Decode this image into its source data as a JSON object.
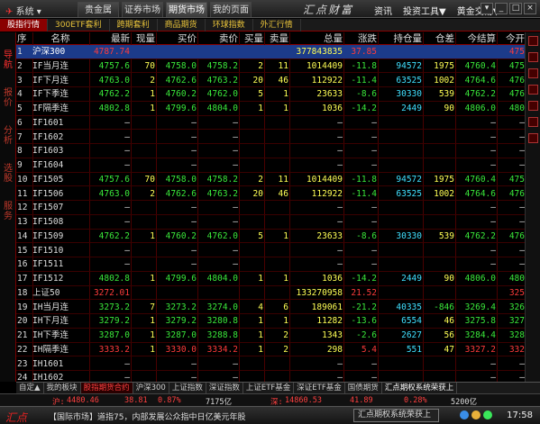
{
  "window": {
    "sys_menu": "系统",
    "top_tabs": [
      "贵金属",
      "证券市场",
      "期货市场",
      "我的页面"
    ],
    "active_top_tab": 2,
    "brand": "汇点财富",
    "top_menu": [
      "资讯",
      "投资工具▼",
      "黄金交易▼"
    ],
    "win_buttons": [
      "▾",
      "_",
      "□",
      "×"
    ]
  },
  "subtabs": {
    "items": [
      "股指行情",
      "300ETF套利",
      "跨期套利",
      "商品期货",
      "环球指数",
      "外汇行情"
    ],
    "active": 0
  },
  "left_strip": {
    "items": [
      "导航",
      "报价",
      "分析",
      "选股",
      "服务"
    ]
  },
  "table": {
    "headers": [
      "序",
      "名称",
      "最新",
      "现量",
      "买价",
      "卖价",
      "买量",
      "卖量",
      "总量",
      "涨跌",
      "持仓量",
      "仓差",
      "今结算",
      "今开"
    ],
    "rows": [
      [
        "1",
        "沪深300",
        "4787.74",
        "",
        "",
        "",
        "",
        "",
        "377843835",
        "37.85",
        "",
        "",
        "",
        "475"
      ],
      [
        "2",
        "IF当月连",
        "4757.6",
        "70",
        "4758.0",
        "4758.2",
        "2",
        "11",
        "1014409",
        "-11.8",
        "94572",
        "1975",
        "4760.4",
        "475"
      ],
      [
        "3",
        "IF下月连",
        "4763.0",
        "2",
        "4762.6",
        "4763.2",
        "20",
        "46",
        "112922",
        "-11.4",
        "63525",
        "1002",
        "4764.6",
        "476"
      ],
      [
        "4",
        "IF下季连",
        "4762.2",
        "1",
        "4760.2",
        "4762.0",
        "5",
        "1",
        "23633",
        "-8.6",
        "30330",
        "539",
        "4762.2",
        "476"
      ],
      [
        "5",
        "IF隔季连",
        "4802.8",
        "1",
        "4799.6",
        "4804.0",
        "1",
        "1",
        "1036",
        "-14.2",
        "2449",
        "90",
        "4806.0",
        "480"
      ],
      [
        "6",
        "IF1601",
        "",
        "",
        "",
        "",
        "",
        "",
        "",
        "",
        "",
        "",
        "",
        ""
      ],
      [
        "7",
        "IF1602",
        "",
        "",
        "",
        "",
        "",
        "",
        "",
        "",
        "",
        "",
        "",
        ""
      ],
      [
        "8",
        "IF1603",
        "",
        "",
        "",
        "",
        "",
        "",
        "",
        "",
        "",
        "",
        "",
        ""
      ],
      [
        "9",
        "IF1604",
        "",
        "",
        "",
        "",
        "",
        "",
        "",
        "",
        "",
        "",
        "",
        ""
      ],
      [
        "10",
        "IF1505",
        "4757.6",
        "70",
        "4758.0",
        "4758.2",
        "2",
        "11",
        "1014409",
        "-11.8",
        "94572",
        "1975",
        "4760.4",
        "475"
      ],
      [
        "11",
        "IF1506",
        "4763.0",
        "2",
        "4762.6",
        "4763.2",
        "20",
        "46",
        "112922",
        "-11.4",
        "63525",
        "1002",
        "4764.6",
        "476"
      ],
      [
        "12",
        "IF1507",
        "",
        "",
        "",
        "",
        "",
        "",
        "",
        "",
        "",
        "",
        "",
        ""
      ],
      [
        "13",
        "IF1508",
        "",
        "",
        "",
        "",
        "",
        "",
        "",
        "",
        "",
        "",
        "",
        ""
      ],
      [
        "14",
        "IF1509",
        "4762.2",
        "1",
        "4760.2",
        "4762.0",
        "5",
        "1",
        "23633",
        "-8.6",
        "30330",
        "539",
        "4762.2",
        "476"
      ],
      [
        "15",
        "IF1510",
        "",
        "",
        "",
        "",
        "",
        "",
        "",
        "",
        "",
        "",
        "",
        ""
      ],
      [
        "16",
        "IF1511",
        "",
        "",
        "",
        "",
        "",
        "",
        "",
        "",
        "",
        "",
        "",
        ""
      ],
      [
        "17",
        "IF1512",
        "4802.8",
        "1",
        "4799.6",
        "4804.0",
        "1",
        "1",
        "1036",
        "-14.2",
        "2449",
        "90",
        "4806.0",
        "480"
      ],
      [
        "18",
        "上证50",
        "3272.01",
        "",
        "",
        "",
        "",
        "",
        "133270958",
        "21.52",
        "",
        "",
        "",
        "325"
      ],
      [
        "19",
        "IH当月连",
        "3273.2",
        "7",
        "3273.2",
        "3274.0",
        "4",
        "6",
        "189061",
        "-21.2",
        "40335",
        "-846",
        "3269.4",
        "326"
      ],
      [
        "20",
        "IH下月连",
        "3279.2",
        "1",
        "3279.2",
        "3280.8",
        "1",
        "1",
        "11282",
        "-13.6",
        "6554",
        "46",
        "3275.8",
        "327"
      ],
      [
        "21",
        "IH下季连",
        "3287.0",
        "1",
        "3287.0",
        "3288.8",
        "1",
        "2",
        "1343",
        "-2.6",
        "2627",
        "56",
        "3284.4",
        "328"
      ],
      [
        "22",
        "IH隔季连",
        "3333.2",
        "1",
        "3330.0",
        "3334.2",
        "1",
        "2",
        "298",
        "5.4",
        "551",
        "47",
        "3327.2",
        "332"
      ],
      [
        "23",
        "IH1601",
        "",
        "",
        "",
        "",
        "",
        "",
        "",
        "",
        "",
        "",
        "",
        ""
      ],
      [
        "24",
        "IH1602",
        "",
        "",
        "",
        "",
        "",
        "",
        "",
        "",
        "",
        "",
        "",
        ""
      ],
      [
        "25",
        "IH1603",
        "",
        "",
        "",
        "",
        "",
        "",
        "",
        "",
        "",
        "",
        "",
        ""
      ],
      [
        "26",
        "IH1604",
        "",
        "",
        "",
        "",
        "",
        "",
        "",
        "",
        "",
        "",
        "",
        ""
      ],
      [
        "27",
        "IH1505",
        "3273.2",
        "7",
        "3273.2",
        "3274.0",
        "4",
        "6",
        "189061",
        "-21.2",
        "40335",
        "-846",
        "3269.4",
        "326"
      ]
    ],
    "selected_row": 0
  },
  "bottom_tabs": {
    "items": [
      "自定▲",
      "我的板块",
      "股指期货合约",
      "沪深300",
      "上证指数",
      "深证指数",
      "上证ETF基金",
      "深证ETF基金",
      "国债期货",
      "汇点期权系统荣获上"
    ],
    "active": 2
  },
  "status": {
    "sh_label": "沪:",
    "sh_index": "4480.46",
    "sh_change": "38.81",
    "sh_pct": "0.87%",
    "sh_amount": "7175亿",
    "sz_label": "深:",
    "sz_index": "14860.53",
    "sz_change": "41.89",
    "sz_pct": "0.28%",
    "sz_amount": "5200亿"
  },
  "taskbar": {
    "logo": "汇点",
    "news": "【国际市场】道指75，内部发展公众指中日亿美元年股",
    "info": "汇点期权系统荣获上",
    "time": "17:58"
  }
}
